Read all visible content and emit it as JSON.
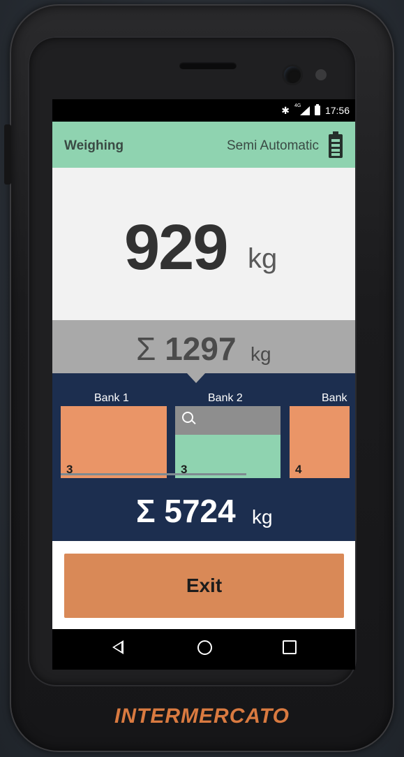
{
  "status_bar": {
    "time": "17:56",
    "bluetooth_icon": "bluetooth-icon",
    "network_label": "4G",
    "signal_icon": "signal-icon",
    "battery_icon": "battery-icon"
  },
  "app_bar": {
    "title": "Weighing",
    "mode": "Semi Automatic",
    "battery_icon": "battery-icon",
    "bg": "#8fd3b0"
  },
  "weight": {
    "value": "929",
    "unit": "kg"
  },
  "sum": {
    "symbol": "Σ",
    "value": "1297",
    "unit": "kg"
  },
  "banks": [
    {
      "label": "Bank 1",
      "count": "3",
      "selected": false
    },
    {
      "label": "Bank 2",
      "count": "3",
      "selected": true,
      "search_icon": "search-icon"
    },
    {
      "label": "Bank",
      "count": "4",
      "selected": false
    }
  ],
  "total": {
    "symbol": "Σ",
    "value": "5724",
    "unit": "kg"
  },
  "exit_label": "Exit",
  "nav": {
    "back_icon": "back-icon",
    "home_icon": "home-icon",
    "recent_icon": "recent-apps-icon"
  },
  "brand": "INTERMERCATO",
  "colors": {
    "bank_orange": "#ea9567",
    "bank_selected": "#8fd3b0",
    "banks_bg": "#1c2e4f",
    "exit_button": "#d98957",
    "brand": "#d97a40"
  }
}
